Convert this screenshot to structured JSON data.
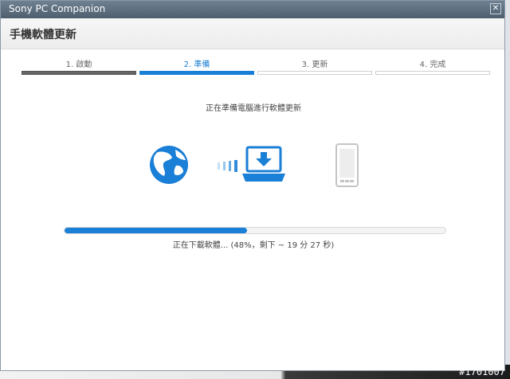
{
  "window": {
    "title": "Sony PC Companion"
  },
  "header": {
    "title": "手機軟體更新"
  },
  "steps": [
    {
      "label": "1. 啟動",
      "state": "done"
    },
    {
      "label": "2. 準備",
      "state": "active"
    },
    {
      "label": "3. 更新",
      "state": "pending"
    },
    {
      "label": "4. 完成",
      "state": "pending"
    }
  ],
  "status": {
    "preparing": "正在準備電腦進行軟體更新",
    "download": "正在下載軟體... (48%，剩下 ~ 19 分 27 秒)"
  },
  "progress": {
    "percent": 48
  },
  "icons": [
    "globe-icon",
    "transfer-dots-icon",
    "laptop-download-icon",
    "phone-icon"
  ],
  "colors": {
    "accent": "#1a7fd6",
    "done": "#666666"
  },
  "watermark": "#1701007"
}
